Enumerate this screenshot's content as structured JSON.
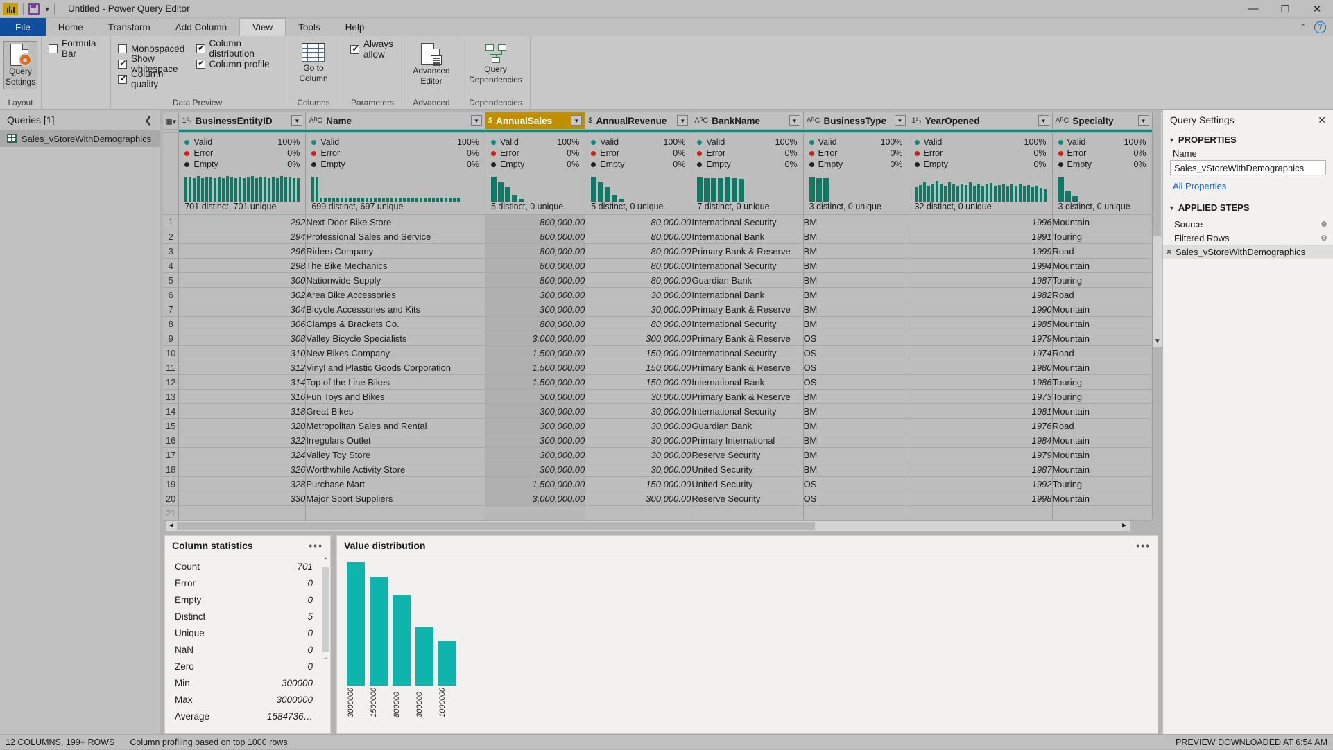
{
  "window": {
    "title": "Untitled - Power Query Editor",
    "app_icon": "chart-icon",
    "save_icon": "save-icon",
    "quick_access_caret": "▾",
    "minimize": "—",
    "maximize": "☐",
    "close": "✕"
  },
  "ribbon": {
    "tabs": [
      {
        "label": "File",
        "active": false
      },
      {
        "label": "Home",
        "active": false
      },
      {
        "label": "Transform",
        "active": false
      },
      {
        "label": "Add Column",
        "active": false
      },
      {
        "label": "View",
        "active": true
      },
      {
        "label": "Tools",
        "active": false
      },
      {
        "label": "Help",
        "active": false
      }
    ],
    "collapse_caret": "⌃",
    "help_glyph": "?",
    "groups": [
      {
        "name": "Layout",
        "big_button": {
          "label1": "Query",
          "label2": "Settings",
          "icon": "query-settings-icon",
          "pressed": true
        },
        "checks": [
          {
            "label": "Formula Bar",
            "checked": false
          }
        ]
      },
      {
        "name": "Data Preview",
        "col1": [
          {
            "label": "Monospaced",
            "checked": false
          },
          {
            "label": "Show whitespace",
            "checked": true
          },
          {
            "label": "Column quality",
            "checked": true
          }
        ],
        "col2": [
          {
            "label": "Column distribution",
            "checked": true
          },
          {
            "label": "Column profile",
            "checked": true
          }
        ]
      },
      {
        "name": "Columns",
        "big_button": {
          "label1": "Go to",
          "label2": "Column",
          "icon": "goto-column-icon",
          "pressed": false
        }
      },
      {
        "name": "Parameters",
        "checks": [
          {
            "label": "Always allow",
            "checked": true
          }
        ]
      },
      {
        "name": "Advanced",
        "big_button": {
          "label1": "Advanced",
          "label2": "Editor",
          "icon": "advanced-editor-icon",
          "pressed": false
        }
      },
      {
        "name": "Dependencies",
        "big_button": {
          "label1": "Query",
          "label2": "Dependencies",
          "icon": "query-dependencies-icon",
          "pressed": false
        }
      }
    ]
  },
  "queries_pane": {
    "header": "Queries [1]",
    "collapse_icon": "chevron-left-icon",
    "items": [
      {
        "label": "Sales_vStoreWithDemographics",
        "icon": "table-icon",
        "selected": true
      }
    ]
  },
  "grid": {
    "select_all_icon": "select-all-icon",
    "columns": [
      {
        "name": "BusinessEntityID",
        "type_icon": "1²₃",
        "selected": false,
        "valid": "100%",
        "error": "0%",
        "empty": "0%",
        "distinct_text": "701 distinct, 701 unique",
        "spark": [
          88,
          90,
          86,
          92,
          84,
          90,
          88,
          86,
          90,
          84,
          92,
          88,
          86,
          90,
          84,
          88,
          92,
          86,
          90,
          88,
          84,
          90,
          86,
          92,
          88,
          90,
          84,
          86
        ]
      },
      {
        "name": "Name",
        "type_icon": "AᴮC",
        "selected": false,
        "valid": "100%",
        "error": "0%",
        "empty": "0%",
        "distinct_text": "699 distinct, 697 unique",
        "spark": [
          90,
          88,
          14,
          14,
          14,
          14,
          14,
          14,
          14,
          14,
          14,
          14,
          14,
          14,
          14,
          14,
          14,
          14,
          14,
          14,
          14,
          14,
          14,
          14,
          14,
          14,
          14,
          14,
          14,
          14,
          14,
          14,
          14,
          14,
          14,
          14
        ]
      },
      {
        "name": "AnnualSales",
        "type_icon": "$",
        "selected": true,
        "valid": "100%",
        "error": "0%",
        "empty": "0%",
        "distinct_text": "5 distinct, 0 unique",
        "spark": [
          90,
          70,
          52,
          26,
          10
        ]
      },
      {
        "name": "AnnualRevenue",
        "type_icon": "$",
        "selected": false,
        "valid": "100%",
        "error": "0%",
        "empty": "0%",
        "distinct_text": "5 distinct, 0 unique",
        "spark": [
          90,
          70,
          52,
          26,
          10
        ]
      },
      {
        "name": "BankName",
        "type_icon": "AᴮC",
        "selected": false,
        "valid": "100%",
        "error": "0%",
        "empty": "0%",
        "distinct_text": "7 distinct, 0 unique",
        "spark": [
          88,
          86,
          84,
          86,
          88,
          84,
          82
        ]
      },
      {
        "name": "BusinessType",
        "type_icon": "AᴮC",
        "selected": false,
        "valid": "100%",
        "error": "0%",
        "empty": "0%",
        "distinct_text": "3 distinct, 0 unique",
        "spark": [
          88,
          86,
          84
        ]
      },
      {
        "name": "YearOpened",
        "type_icon": "1²₃",
        "selected": false,
        "valid": "100%",
        "error": "0%",
        "empty": "0%",
        "distinct_text": "32 distinct, 0 unique",
        "spark": [
          52,
          60,
          70,
          58,
          62,
          74,
          66,
          58,
          70,
          62,
          56,
          66,
          60,
          70,
          58,
          64,
          54,
          62,
          68,
          58,
          60,
          66,
          56,
          62,
          58,
          64,
          54,
          60,
          52,
          58,
          50,
          46
        ]
      },
      {
        "name": "Specialty",
        "type_icon": "AᴮC",
        "selected": false,
        "valid": "100%",
        "error": "0%",
        "empty": "0%",
        "distinct_text": "3 distinct, 0 unique",
        "spark": [
          88,
          40,
          20
        ]
      }
    ],
    "quality_labels": {
      "valid": "Valid",
      "error": "Error",
      "empty": "Empty"
    },
    "rows": [
      {
        "n": "1",
        "BusinessEntityID": "292",
        "Name": "Next-Door Bike Store",
        "AnnualSales": "800,000.00",
        "AnnualRevenue": "80,000.00",
        "BankName": "International Security",
        "BusinessType": "BM",
        "YearOpened": "1996",
        "Specialty": "Mountain"
      },
      {
        "n": "2",
        "BusinessEntityID": "294",
        "Name": "Professional Sales and Service",
        "AnnualSales": "800,000.00",
        "AnnualRevenue": "80,000.00",
        "BankName": "International Bank",
        "BusinessType": "BM",
        "YearOpened": "1991",
        "Specialty": "Touring"
      },
      {
        "n": "3",
        "BusinessEntityID": "296",
        "Name": "Riders Company",
        "AnnualSales": "800,000.00",
        "AnnualRevenue": "80,000.00",
        "BankName": "Primary Bank & Reserve",
        "BusinessType": "BM",
        "YearOpened": "1999",
        "Specialty": "Road"
      },
      {
        "n": "4",
        "BusinessEntityID": "298",
        "Name": "The Bike Mechanics",
        "AnnualSales": "800,000.00",
        "AnnualRevenue": "80,000.00",
        "BankName": "International Security",
        "BusinessType": "BM",
        "YearOpened": "1994",
        "Specialty": "Mountain"
      },
      {
        "n": "5",
        "BusinessEntityID": "300",
        "Name": "Nationwide Supply",
        "AnnualSales": "800,000.00",
        "AnnualRevenue": "80,000.00",
        "BankName": "Guardian Bank",
        "BusinessType": "BM",
        "YearOpened": "1987",
        "Specialty": "Touring"
      },
      {
        "n": "6",
        "BusinessEntityID": "302",
        "Name": "Area Bike Accessories",
        "AnnualSales": "300,000.00",
        "AnnualRevenue": "30,000.00",
        "BankName": "International Bank",
        "BusinessType": "BM",
        "YearOpened": "1982",
        "Specialty": "Road"
      },
      {
        "n": "7",
        "BusinessEntityID": "304",
        "Name": "Bicycle Accessories and Kits",
        "AnnualSales": "300,000.00",
        "AnnualRevenue": "30,000.00",
        "BankName": "Primary Bank & Reserve",
        "BusinessType": "BM",
        "YearOpened": "1990",
        "Specialty": "Mountain"
      },
      {
        "n": "8",
        "BusinessEntityID": "306",
        "Name": "Clamps & Brackets Co.",
        "AnnualSales": "800,000.00",
        "AnnualRevenue": "80,000.00",
        "BankName": "International Security",
        "BusinessType": "BM",
        "YearOpened": "1985",
        "Specialty": "Mountain"
      },
      {
        "n": "9",
        "BusinessEntityID": "308",
        "Name": "Valley Bicycle Specialists",
        "AnnualSales": "3,000,000.00",
        "AnnualRevenue": "300,000.00",
        "BankName": "Primary Bank & Reserve",
        "BusinessType": "OS",
        "YearOpened": "1979",
        "Specialty": "Mountain"
      },
      {
        "n": "10",
        "BusinessEntityID": "310",
        "Name": "New Bikes Company",
        "AnnualSales": "1,500,000.00",
        "AnnualRevenue": "150,000.00",
        "BankName": "International Security",
        "BusinessType": "OS",
        "YearOpened": "1974",
        "Specialty": "Road"
      },
      {
        "n": "11",
        "BusinessEntityID": "312",
        "Name": "Vinyl and Plastic Goods Corporation",
        "AnnualSales": "1,500,000.00",
        "AnnualRevenue": "150,000.00",
        "BankName": "Primary Bank & Reserve",
        "BusinessType": "OS",
        "YearOpened": "1980",
        "Specialty": "Mountain"
      },
      {
        "n": "12",
        "BusinessEntityID": "314",
        "Name": "Top of the Line Bikes",
        "AnnualSales": "1,500,000.00",
        "AnnualRevenue": "150,000.00",
        "BankName": "International Bank",
        "BusinessType": "OS",
        "YearOpened": "1986",
        "Specialty": "Touring"
      },
      {
        "n": "13",
        "BusinessEntityID": "316",
        "Name": "Fun Toys and Bikes",
        "AnnualSales": "300,000.00",
        "AnnualRevenue": "30,000.00",
        "BankName": "Primary Bank & Reserve",
        "BusinessType": "BM",
        "YearOpened": "1973",
        "Specialty": "Touring"
      },
      {
        "n": "14",
        "BusinessEntityID": "318",
        "Name": "Great Bikes",
        "AnnualSales": "300,000.00",
        "AnnualRevenue": "30,000.00",
        "BankName": "International Security",
        "BusinessType": "BM",
        "YearOpened": "1981",
        "Specialty": "Mountain"
      },
      {
        "n": "15",
        "BusinessEntityID": "320",
        "Name": "Metropolitan Sales and Rental",
        "AnnualSales": "300,000.00",
        "AnnualRevenue": "30,000.00",
        "BankName": "Guardian Bank",
        "BusinessType": "BM",
        "YearOpened": "1976",
        "Specialty": "Road"
      },
      {
        "n": "16",
        "BusinessEntityID": "322",
        "Name": "Irregulars Outlet",
        "AnnualSales": "300,000.00",
        "AnnualRevenue": "30,000.00",
        "BankName": "Primary International",
        "BusinessType": "BM",
        "YearOpened": "1984",
        "Specialty": "Mountain"
      },
      {
        "n": "17",
        "BusinessEntityID": "324",
        "Name": "Valley Toy Store",
        "AnnualSales": "300,000.00",
        "AnnualRevenue": "30,000.00",
        "BankName": "Reserve Security",
        "BusinessType": "BM",
        "YearOpened": "1979",
        "Specialty": "Mountain"
      },
      {
        "n": "18",
        "BusinessEntityID": "326",
        "Name": "Worthwhile Activity Store",
        "AnnualSales": "300,000.00",
        "AnnualRevenue": "30,000.00",
        "BankName": "United Security",
        "BusinessType": "BM",
        "YearOpened": "1987",
        "Specialty": "Mountain"
      },
      {
        "n": "19",
        "BusinessEntityID": "328",
        "Name": "Purchase Mart",
        "AnnualSales": "1,500,000.00",
        "AnnualRevenue": "150,000.00",
        "BankName": "United Security",
        "BusinessType": "OS",
        "YearOpened": "1992",
        "Specialty": "Touring"
      },
      {
        "n": "20",
        "BusinessEntityID": "330",
        "Name": "Major Sport Suppliers",
        "AnnualSales": "3,000,000.00",
        "AnnualRevenue": "300,000.00",
        "BankName": "Reserve Security",
        "BusinessType": "OS",
        "YearOpened": "1998",
        "Specialty": "Mountain"
      },
      {
        "n": "21",
        "BusinessEntityID": "",
        "Name": "",
        "AnnualSales": "",
        "AnnualRevenue": "",
        "BankName": "",
        "BusinessType": "",
        "YearOpened": "",
        "Specialty": ""
      }
    ],
    "row1_banknames_override": [
      "United Security",
      "International Bank",
      "Primary Bank & Reserve",
      "International Security",
      "Guardian Bank"
    ]
  },
  "column_statistics": {
    "title": "Column statistics",
    "menu_icon": "ellipsis-icon",
    "rows": [
      {
        "label": "Count",
        "value": "701"
      },
      {
        "label": "Error",
        "value": "0"
      },
      {
        "label": "Empty",
        "value": "0"
      },
      {
        "label": "Distinct",
        "value": "5"
      },
      {
        "label": "Unique",
        "value": "0"
      },
      {
        "label": "NaN",
        "value": "0"
      },
      {
        "label": "Zero",
        "value": "0"
      },
      {
        "label": "Min",
        "value": "300000"
      },
      {
        "label": "Max",
        "value": "3000000"
      },
      {
        "label": "Average",
        "value": "1584736…"
      }
    ],
    "scroll_up_icon": "chevron-up-icon",
    "scroll_down_icon": "chevron-down-icon"
  },
  "value_distribution": {
    "title": "Value distribution",
    "menu_icon": "ellipsis-icon"
  },
  "chart_data": {
    "type": "bar",
    "title": "Value distribution",
    "categories": [
      "3000000",
      "1500000",
      "800000",
      "300000",
      "1000000"
    ],
    "values": [
      210,
      185,
      155,
      100,
      75
    ],
    "xlabel": "",
    "ylabel": "",
    "grid": false,
    "legend": "none",
    "color": "#0fb5ad"
  },
  "query_settings": {
    "header": "Query Settings",
    "close_icon": "close-icon",
    "properties_section": "PROPERTIES",
    "name_label": "Name",
    "name_value": "Sales_vStoreWithDemographics",
    "all_properties_link": "All Properties",
    "applied_steps_section": "APPLIED STEPS",
    "steps": [
      {
        "label": "Source",
        "gear": "gear-icon",
        "selected": false,
        "deletable": false
      },
      {
        "label": "Filtered Rows",
        "gear": "gear-icon",
        "selected": false,
        "deletable": false
      },
      {
        "label": "Sales_vStoreWithDemographics",
        "gear": "",
        "selected": true,
        "deletable": true
      }
    ],
    "delete_icon": "✕"
  },
  "status_bar": {
    "columns_rows": "12 COLUMNS, 199+ ROWS",
    "profiling": "Column profiling based on top 1000 rows",
    "preview_downloaded": "PREVIEW DOWNLOADED AT 6:54 AM"
  },
  "colors": {
    "accent_teal": "#0fb5ad",
    "spark_teal": "#117865",
    "selected_column": "#bf8f00",
    "file_tab_blue": "#0d4f9e",
    "error_red": "#c4241c",
    "link_blue": "#0b63c5"
  }
}
